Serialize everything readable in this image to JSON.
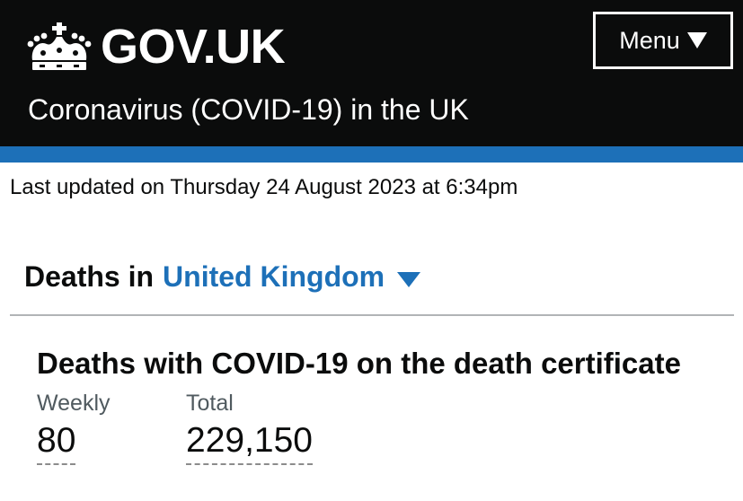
{
  "header": {
    "logo_text": "GOV.UK",
    "logo_icon": "crown-icon",
    "service_name": "Coronavirus (COVID-19) in the UK",
    "menu_label": "Menu",
    "menu_icon": "triangle-down-icon",
    "background_color": "#0b0c0c",
    "accent_bar_color": "#1d70b8"
  },
  "last_updated": "Last updated on Thursday 24 August 2023 at 6:34pm",
  "area": {
    "prefix": "Deaths in",
    "selected": "United Kingdom",
    "dropdown_icon": "triangle-down-icon",
    "link_color": "#1d70b8"
  },
  "card": {
    "title": "Deaths with COVID-19 on the death certificate",
    "metrics": [
      {
        "label": "Weekly",
        "value": "80"
      },
      {
        "label": "Total",
        "value": "229,150"
      }
    ]
  }
}
